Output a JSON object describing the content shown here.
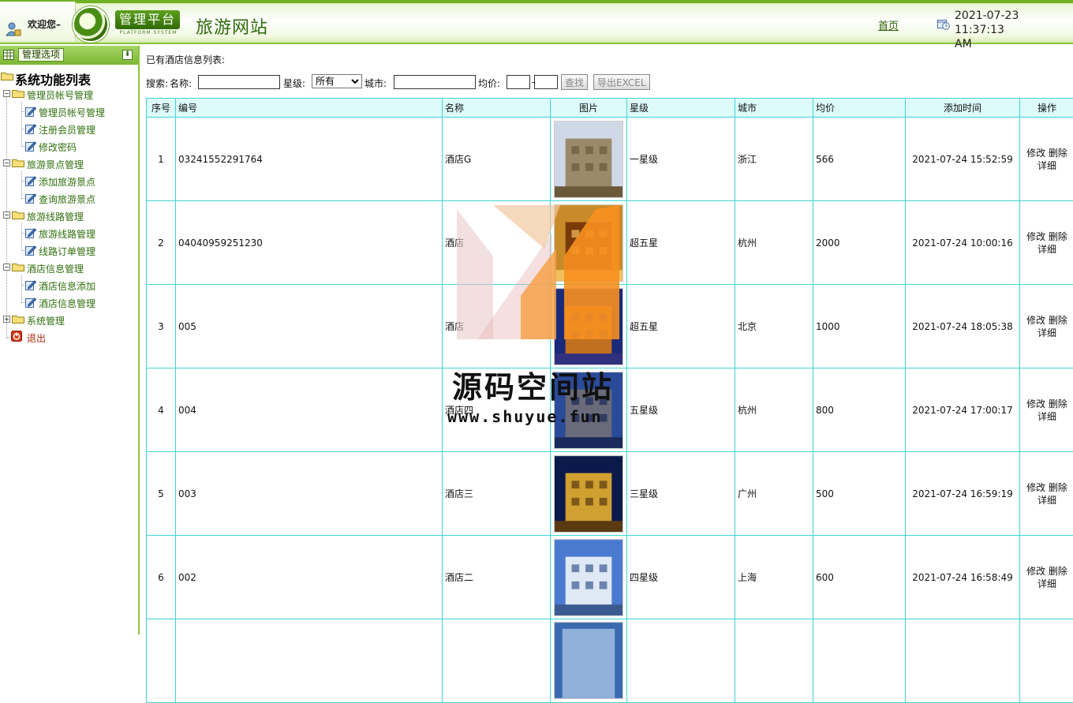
{
  "header": {
    "welcome": "欢迎您–",
    "logo_badge": "管理平台",
    "logo_sub": "PLATFORM SYSTEM",
    "site_title": "旅游网站",
    "home_link": "首页",
    "datetime_line1": "2021-07-23 11:37:13",
    "datetime_line2": "AM"
  },
  "sidebar": {
    "options_label": "管理选项",
    "root": "系统功能列表",
    "groups": [
      {
        "label": "管理员帐号管理",
        "items": [
          "管理员帐号管理",
          "注册会员管理",
          "修改密码"
        ]
      },
      {
        "label": "旅游景点管理",
        "items": [
          "添加旅游景点",
          "查询旅游景点"
        ]
      },
      {
        "label": "旅游线路管理",
        "items": [
          "旅游线路管理",
          "线路订单管理"
        ]
      },
      {
        "label": "酒店信息管理",
        "items": [
          "酒店信息添加",
          "酒店信息管理"
        ]
      },
      {
        "label": "系统管理",
        "items": []
      }
    ],
    "logout": "退出"
  },
  "main": {
    "list_title": "已有酒店信息列表:",
    "search": {
      "search_label": "搜索:",
      "name_label": "名称:",
      "name_value": "",
      "star_label": "星级:",
      "star_selected": "所有",
      "city_label": "城市:",
      "city_value": "",
      "price_label": "均价:",
      "price_from": "",
      "price_sep": "-",
      "price_to": "",
      "find_button": "查找",
      "export_button": "导出EXCEL"
    },
    "table": {
      "headers": [
        "序号",
        "编号",
        "名称",
        "图片",
        "星级",
        "城市",
        "均价",
        "添加时间",
        "操作"
      ],
      "rows": [
        {
          "idx": "1",
          "code": "03241552291764",
          "name": "酒店G",
          "star": "一星级",
          "city": "浙江",
          "price": "566",
          "time": "2021-07-24 15:52:59"
        },
        {
          "idx": "2",
          "code": "04040959251230",
          "name": "酒店",
          "star": "超五星",
          "city": "杭州",
          "price": "2000",
          "time": "2021-07-24 10:00:16"
        },
        {
          "idx": "3",
          "code": "005",
          "name": "酒店",
          "star": "超五星",
          "city": "北京",
          "price": "1000",
          "time": "2021-07-24 18:05:38"
        },
        {
          "idx": "4",
          "code": "004",
          "name": "酒店四",
          "star": "五星级",
          "city": "杭州",
          "price": "800",
          "time": "2021-07-24 17:00:17"
        },
        {
          "idx": "5",
          "code": "003",
          "name": "酒店三",
          "star": "三星级",
          "city": "广州",
          "price": "500",
          "time": "2021-07-24 16:59:19"
        },
        {
          "idx": "6",
          "code": "002",
          "name": "酒店二",
          "star": "四星级",
          "city": "上海",
          "price": "600",
          "time": "2021-07-24 16:58:49"
        }
      ],
      "ops": {
        "edit": "修改",
        "delete": "删除",
        "detail": "详细"
      }
    }
  },
  "watermark": {
    "text": "源码空间站",
    "url": "www.shuyue.fun"
  }
}
